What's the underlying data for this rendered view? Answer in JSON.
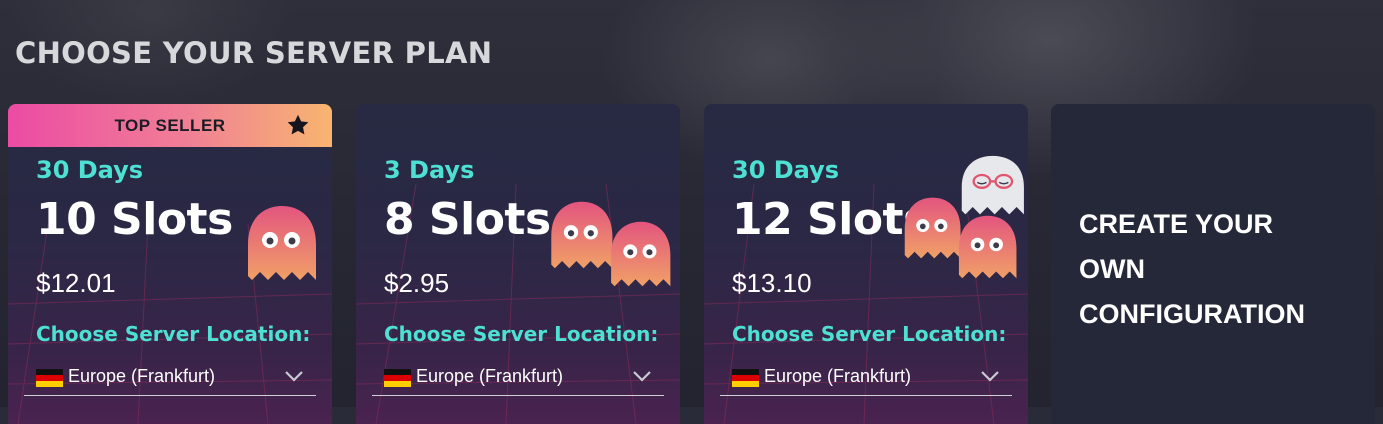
{
  "heading": "CHOOSE YOUR SERVER PLAN",
  "plans": [
    {
      "badge": "TOP SELLER",
      "duration": "30 Days",
      "slots": "10 Slots",
      "price": "$12.01",
      "location_label": "Choose Server Location:",
      "location_value": "Europe (Frankfurt)"
    },
    {
      "duration": "3 Days",
      "slots": "8 Slots",
      "price": "$2.95",
      "location_label": "Choose Server Location:",
      "location_value": "Europe (Frankfurt)"
    },
    {
      "duration": "30 Days",
      "slots": "12 Slots",
      "price": "$13.10",
      "location_label": "Choose Server Location:",
      "location_value": "Europe (Frankfurt)"
    }
  ],
  "custom": {
    "line1": "CREATE YOUR",
    "line2": "OWN",
    "line3": "CONFIGURATION"
  },
  "colors": {
    "accent_cyan": "#4de0d3",
    "badge_gradient_start": "#ec4ba3",
    "badge_gradient_end": "#f8b56f",
    "ghost_pink": "#e0577f"
  },
  "icons": {
    "badge": "star-icon",
    "select": "chevron-down-icon",
    "flag": "germany-flag-icon",
    "mascot": "ghost-icon"
  }
}
